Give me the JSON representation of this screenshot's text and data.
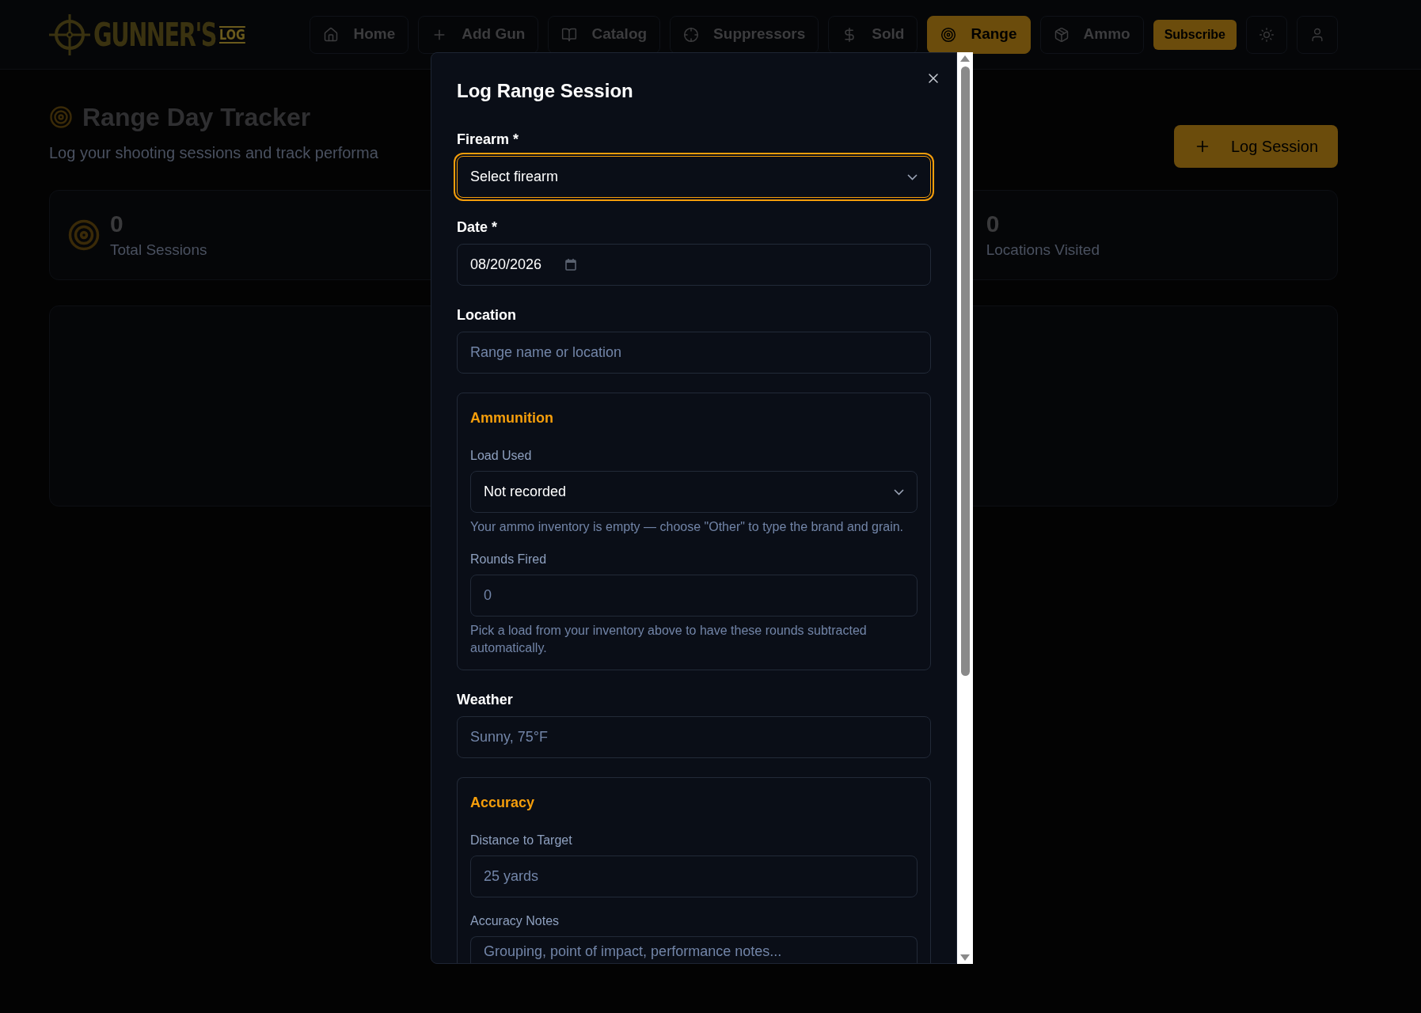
{
  "header": {
    "logo": {
      "main": "GUNNER'S",
      "small": "LOG"
    },
    "nav": [
      {
        "label": "Home",
        "selected": false
      },
      {
        "label": "Add Gun",
        "selected": false
      },
      {
        "label": "Catalog",
        "selected": false
      },
      {
        "label": "Suppressors",
        "selected": false
      },
      {
        "label": "Sold",
        "selected": false
      },
      {
        "label": "Range",
        "selected": true
      },
      {
        "label": "Ammo",
        "selected": false
      }
    ],
    "subscribe": "Subscribe"
  },
  "page": {
    "title": "Range Day Tracker",
    "subtitle": "Log your shooting sessions and track performa",
    "action": "Log Session",
    "stats": [
      {
        "value": "0",
        "label": "Total Sessions",
        "kind": "icon"
      },
      {
        "value": "0",
        "label": "Locations Visited",
        "kind": "plain"
      }
    ]
  },
  "modal": {
    "title": "Log Range Session",
    "fields": [
      {
        "kind": "select",
        "label": "Firearm *",
        "value": "Select firearm",
        "focused": true
      },
      {
        "kind": "date",
        "label": "Date *",
        "value": "08/20/2026",
        "focused": false
      },
      {
        "kind": "text",
        "label": "Location",
        "placeholder": "Range name or location",
        "focused": false
      },
      {
        "kind": "group",
        "title": "Ammunition",
        "fields": [
          {
            "kind": "select",
            "label": "Load Used",
            "value": "Not recorded",
            "help": "Your ammo inventory is empty — choose \"Other\" to type the brand and grain.",
            "focused": false
          },
          {
            "kind": "text",
            "label": "Rounds Fired",
            "placeholder": "0",
            "help": "Pick a load from your inventory above to have these rounds subtracted automatically.",
            "focused": false
          }
        ]
      },
      {
        "kind": "text",
        "label": "Weather",
        "placeholder": "Sunny, 75°F",
        "focused": false
      },
      {
        "kind": "group",
        "title": "Accuracy",
        "fields": [
          {
            "kind": "text",
            "label": "Distance to Target",
            "placeholder": "25 yards",
            "focused": false
          },
          {
            "kind": "textarea",
            "label": "Accuracy Notes",
            "placeholder": "Grouping, point of impact, performance notes...",
            "focused": false
          }
        ]
      }
    ]
  }
}
